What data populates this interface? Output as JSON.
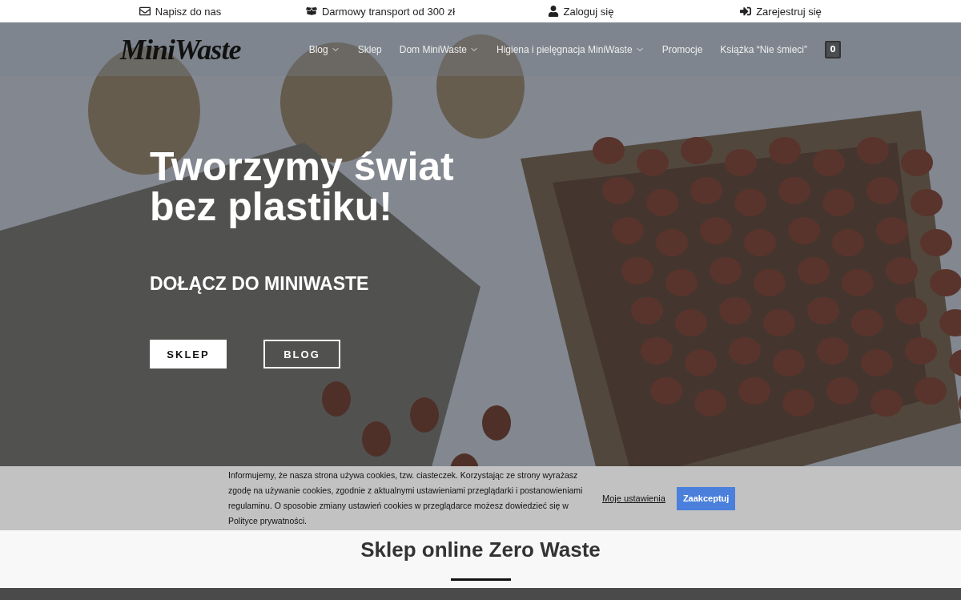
{
  "topbar": [
    {
      "kind": "mail",
      "label": "Napisz do nas"
    },
    {
      "kind": "box",
      "label": "Darmowy transport od 300 zł"
    },
    {
      "kind": "user",
      "label": "Zaloguj się"
    },
    {
      "kind": "login",
      "label": "Zarejestruj się"
    }
  ],
  "logo": "MiniWaste",
  "nav": [
    {
      "label": "Blog",
      "dropdown": true
    },
    {
      "label": "Sklep",
      "dropdown": false
    },
    {
      "label": "Dom MiniWaste",
      "dropdown": true
    },
    {
      "label": "Higiena i pielęgnacja MiniWaste",
      "dropdown": true
    },
    {
      "label": "Promocje",
      "dropdown": false
    },
    {
      "label": "Książka “Nie śmieci”",
      "dropdown": false
    }
  ],
  "cart_count": "0",
  "hero": {
    "title_lines": [
      "Tworzymy świat",
      "bez plastiku!"
    ],
    "subtitle": "DOŁĄCZ DO MINIWASTE",
    "buttons": [
      {
        "label": "SKLEP",
        "kind": "solid"
      },
      {
        "label": "BLOG",
        "kind": "outline"
      }
    ]
  },
  "section": {
    "heading": "Sklep online Zero Waste"
  },
  "cookie_banner": {
    "text": "Informujemy, że nasza strona używa cookies, tzw. ciasteczek. Korzystając ze strony wyrażasz zgodę na używanie cookies, zgodnie z aktualnymi ustawieniami przeglądarki i postanowieniami regulaminu. O sposobie zmiany ustawień cookies w przeglądarce możesz dowiedzieć się w Polityce prywatności.",
    "settings_link": "Moje ustawienia",
    "accept": "Zaakceptuj"
  }
}
